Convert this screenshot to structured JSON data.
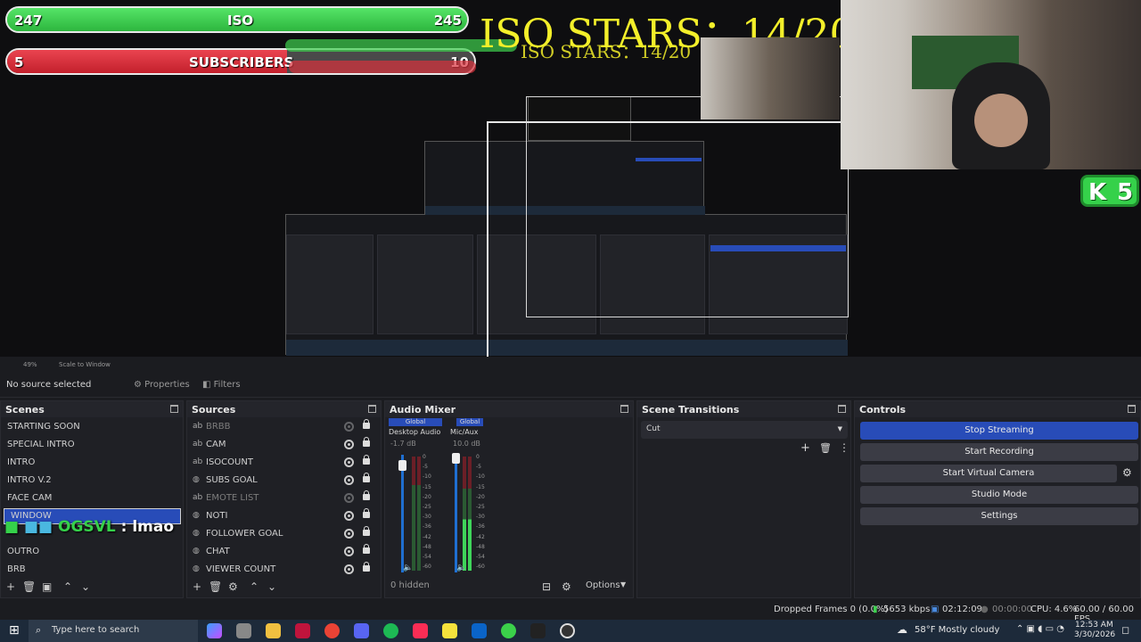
{
  "overlay": {
    "iso_bar": {
      "left_value": "247",
      "label": "ISO",
      "right_value": "245"
    },
    "subs_bar": {
      "left_value": "5",
      "label": "SUBSCRIBERS",
      "right_value": "10"
    },
    "iso_stars": "ISO STARS：14/20",
    "kick_badge": {
      "letter": "K",
      "count": "5"
    },
    "chat": {
      "user": "OGSVL",
      "separator": ":",
      "message": "lmao"
    }
  },
  "preview_toolbar": {
    "zoom": "49%",
    "scale": "Scale to Window"
  },
  "properties_row": {
    "no_source": "No source selected",
    "properties": "Properties",
    "filters": "Filters"
  },
  "scenes": {
    "title": "Scenes",
    "items": [
      "STARTING SOON",
      "SPECIAL INTRO",
      "INTRO",
      "INTRO V.2",
      "FACE CAM",
      "WINDOW",
      "",
      "OUTRO",
      "BRB"
    ],
    "selected": "WINDOW"
  },
  "sources": {
    "title": "Sources",
    "items": [
      {
        "name": "BRBB",
        "hidden": true
      },
      {
        "name": "CAM",
        "hidden": false
      },
      {
        "name": "ISOCOUNT",
        "hidden": false
      },
      {
        "name": "SUBS GOAL",
        "hidden": false
      },
      {
        "name": "EMOTE LIST",
        "hidden": true
      },
      {
        "name": "NOTI",
        "hidden": false
      },
      {
        "name": "FOLLOWER GOAL",
        "hidden": false
      },
      {
        "name": "CHAT",
        "hidden": false
      },
      {
        "name": "VIEWER COUNT",
        "hidden": false
      }
    ]
  },
  "audio_mixer": {
    "title": "Audio Mixer",
    "channels": [
      {
        "badge": "Global",
        "name": "Desktop Audio",
        "db": "-1.7 dB"
      },
      {
        "badge": "Global",
        "name": "Mic/Aux",
        "db": "10.0 dB"
      }
    ],
    "scale": [
      "0",
      "-5",
      "-10",
      "-15",
      "-20",
      "-25",
      "-30",
      "-36",
      "-42",
      "-48",
      "-54",
      "-60"
    ],
    "hidden": "0 hidden",
    "options": "Options"
  },
  "scene_transitions": {
    "title": "Scene Transitions",
    "selected": "Cut"
  },
  "controls": {
    "title": "Controls",
    "buttons": [
      "Stop Streaming",
      "Start Recording",
      "Start Virtual Camera",
      "Studio Mode",
      "Settings"
    ]
  },
  "status": {
    "dropped": "Dropped Frames 0 (0.0%)",
    "bitrate": "5653 kbps",
    "live_time": "02:12:09",
    "rec_time": "00:00:00",
    "cpu": "CPU: 4.6%",
    "fps": "60.00 / 60.00 FPS"
  },
  "taskbar": {
    "search_placeholder": "Type here to search",
    "weather": "58°F  Mostly cloudy",
    "time": "12:53 AM",
    "date": "3/30/2026"
  },
  "colors": {
    "accent": "#284cb8",
    "iso_green": "#3ed14f",
    "subs_red": "#d9303c",
    "stars_yellow": "#f3ef2a",
    "kick_green": "#35d14a"
  }
}
